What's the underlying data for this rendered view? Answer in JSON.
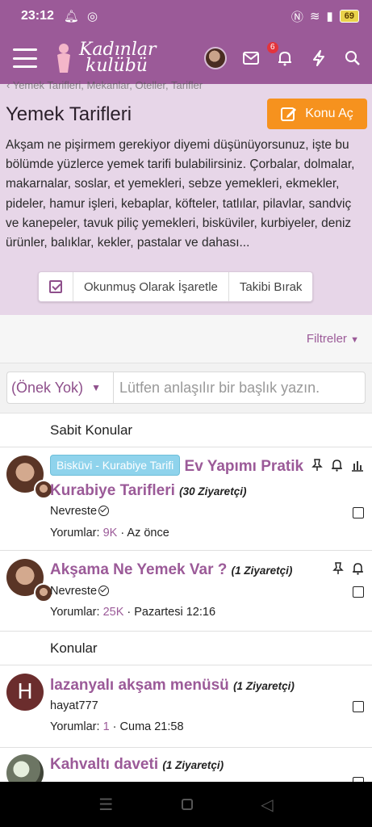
{
  "status": {
    "time": "23:12",
    "battery": "69"
  },
  "app": {
    "logo_line1": "Kadınlar",
    "logo_line2": "kulübü",
    "notif_count": "6"
  },
  "header": {
    "breadcrumb": "Yemek Tarifleri, Mekanlar, Oteller, Tarifler",
    "title": "Yemek Tarifleri",
    "new_topic": "Konu Aç",
    "description": "Akşam ne pişirmem gerekiyor diyemi düşünüyorsunuz, işte bu bölümde yüzlerce yemek tarifi bulabilirsiniz. Çorbalar, dolmalar, makarnalar, soslar, et yemekleri, sebze yemekleri, ekmekler, pideler, hamur işleri, kebaplar, köfteler, tatlılar, pilavlar, sandviç ve kanepeler, tavuk piliç yemekleri, bisküviler, kurbiyeler, deniz ürünler, balıklar, kekler, pastalar ve dahası...",
    "mark_read": "Okunmuş Olarak İşaretle",
    "unfollow": "Takibi Bırak"
  },
  "filters_label": "Filtreler",
  "search": {
    "prefix": "(Önek Yok)",
    "placeholder": "Lütfen anlaşılır bir başlık yazın."
  },
  "sections": {
    "sticky": "Sabit Konular",
    "topics": "Konular"
  },
  "threads": [
    {
      "tag": "Bisküvi - Kurabiye Tarifi",
      "title_a": "Ev Yapımı",
      "title_b": "Pratik Kurabiye Tarifleri",
      "visits": "(30 Ziyaretçi)",
      "author": "Nevreste",
      "replies_label": "Yorumlar:",
      "replies": "9K",
      "time": "Az önce"
    },
    {
      "title": "Akşama Ne Yemek Var ?",
      "visits": "(1 Ziyaretçi)",
      "author": "Nevreste",
      "replies_label": "Yorumlar:",
      "replies": "25K",
      "time": "Pazartesi 12:16"
    },
    {
      "avatar_letter": "H",
      "title": "lazanyalı akşam menüsü",
      "visits": "(1 Ziyaretçi)",
      "author": "hayat777",
      "replies_label": "Yorumlar:",
      "replies": "1",
      "time": "Cuma 21:58"
    },
    {
      "title": "Kahvaltı daveti",
      "visits": "(1 Ziyaretçi)"
    }
  ]
}
